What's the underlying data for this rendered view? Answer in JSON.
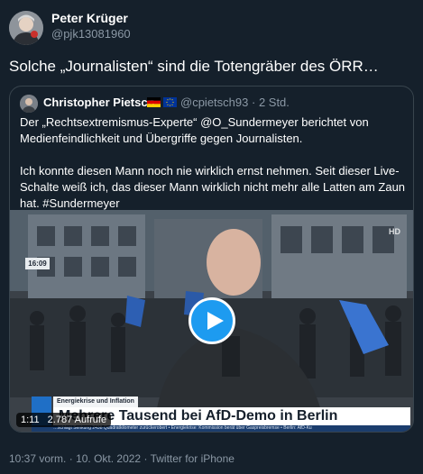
{
  "tweet": {
    "author": {
      "name": "Peter Krüger",
      "handle": "@pjk13081960"
    },
    "text": "Solche „Journalisten“ sind die Totengräber des ÖRR…",
    "timestamp": "10:37 vorm.",
    "date": "10. Okt. 2022",
    "source": "Twitter for iPhone"
  },
  "quote": {
    "author": {
      "name": "Christopher Pietsch",
      "handle": "@cpietsch93",
      "age": "2 Std.",
      "flags": [
        "germany-flag-icon",
        "eu-flag-icon"
      ]
    },
    "paragraphs": [
      "Der „Rechtsextremismus-Experte“ @O_Sundermeyer berichtet von Medienfeindlichkeit und Übergriffe gegen Journalisten.",
      "Ich konnte diesen Mann noch nie wirklich ernst nehmen. Seit dieser Live-Schalte weiß ich, das dieser Mann wirklich nicht mehr alle Latten am Zaun hat. #Sundermeyer"
    ]
  },
  "video": {
    "clock": "16:09",
    "channel_logo": "HD",
    "lower_third": {
      "topic": "Energiekrise und Inflation",
      "headline": "Mehrere Tausend bei AfD-Demo in Berlin",
      "ticker": "…schlagt Senkung 2438 Quadratkilometer zurückerobert  • Energiekrise: Kommission berät über Gaspreisbremse  • Berlin: AfD-Ku"
    },
    "duration": "1:11",
    "views": "2.787 Aufrufe",
    "colors": {
      "play_button": "#1d9bf0",
      "lower_third_badge": "#1f6fc6"
    }
  },
  "colors": {
    "background": "#15202b",
    "secondary_text": "#8b98a5",
    "border": "#38444d"
  }
}
